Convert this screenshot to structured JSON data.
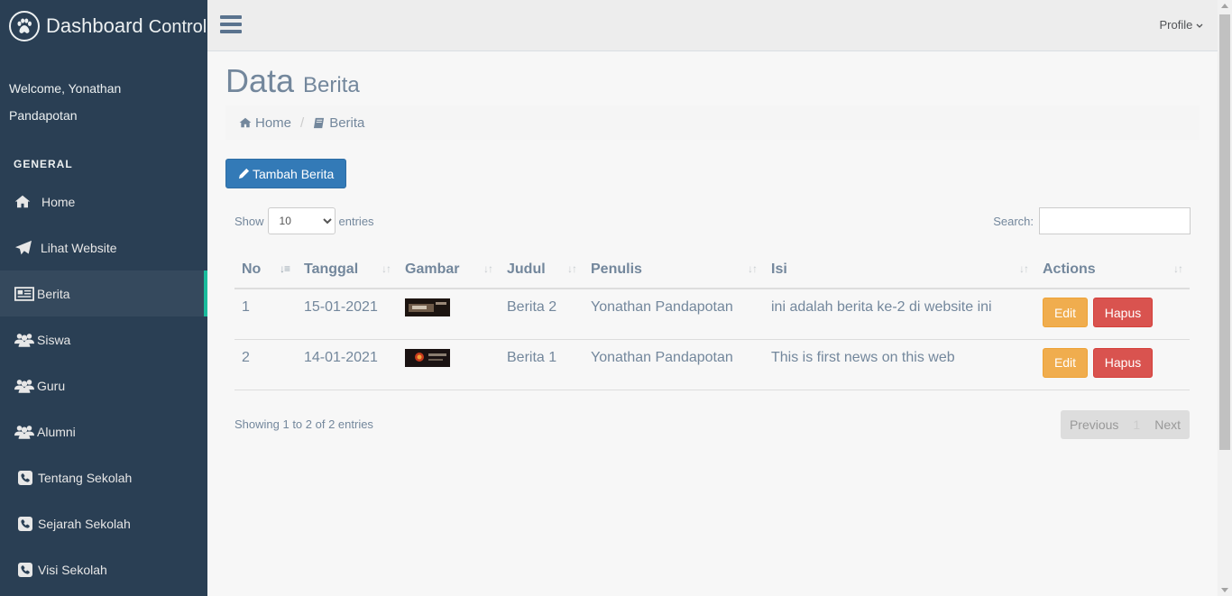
{
  "brand": {
    "title_main": "Dashboard",
    "title_sub": "Control",
    "logo_icon": "paw-icon"
  },
  "welcome": {
    "line1": "Welcome, Yonathan",
    "line2": "Pandapotan"
  },
  "sidebar": {
    "section": "GENERAL",
    "items": [
      {
        "label": "Home",
        "icon": "home-icon"
      },
      {
        "label": "Lihat Website",
        "icon": "paper-plane-icon"
      },
      {
        "label": "Berita",
        "icon": "newspaper-icon",
        "active": true
      },
      {
        "label": "Siswa",
        "icon": "users-icon"
      },
      {
        "label": "Guru",
        "icon": "users-icon"
      },
      {
        "label": "Alumni",
        "icon": "users-icon"
      },
      {
        "label": "Tentang Sekolah",
        "icon": "phone-icon"
      },
      {
        "label": "Sejarah Sekolah",
        "icon": "phone-icon"
      },
      {
        "label": "Visi Sekolah",
        "icon": "phone-icon"
      }
    ],
    "accent_color": "#1abb9c"
  },
  "topnav": {
    "profile_label": "Profile"
  },
  "page": {
    "title_big": "Data",
    "title_small": "Berita",
    "breadcrumb": {
      "home": "Home",
      "current": "Berita"
    },
    "add_button": "Tambah Berita"
  },
  "table_controls": {
    "show_label": "Show",
    "entries_value": "10",
    "entries_label": "entries",
    "search_label": "Search:",
    "search_value": ""
  },
  "table": {
    "headers": [
      "No",
      "Tanggal",
      "Gambar",
      "Judul",
      "Penulis",
      "Isi",
      "Actions"
    ],
    "rows": [
      {
        "no": "1",
        "tanggal": "15-01-2021",
        "judul": "Berita 2",
        "penulis": "Yonathan Pandapotan",
        "isi": "ini adalah berita ke-2 di website ini",
        "edit": "Edit",
        "hapus": "Hapus"
      },
      {
        "no": "2",
        "tanggal": "14-01-2021",
        "judul": "Berita 1",
        "penulis": "Yonathan Pandapotan",
        "isi": "This is first news on this web",
        "edit": "Edit",
        "hapus": "Hapus"
      }
    ]
  },
  "footer": {
    "info": "Showing 1 to 2 of 2 entries",
    "previous": "Previous",
    "page": "1",
    "next": "Next"
  },
  "colors": {
    "sidebar_bg": "#2a3f54",
    "primary": "#337ab7",
    "warning": "#f0ad4e",
    "danger": "#d9534f"
  }
}
